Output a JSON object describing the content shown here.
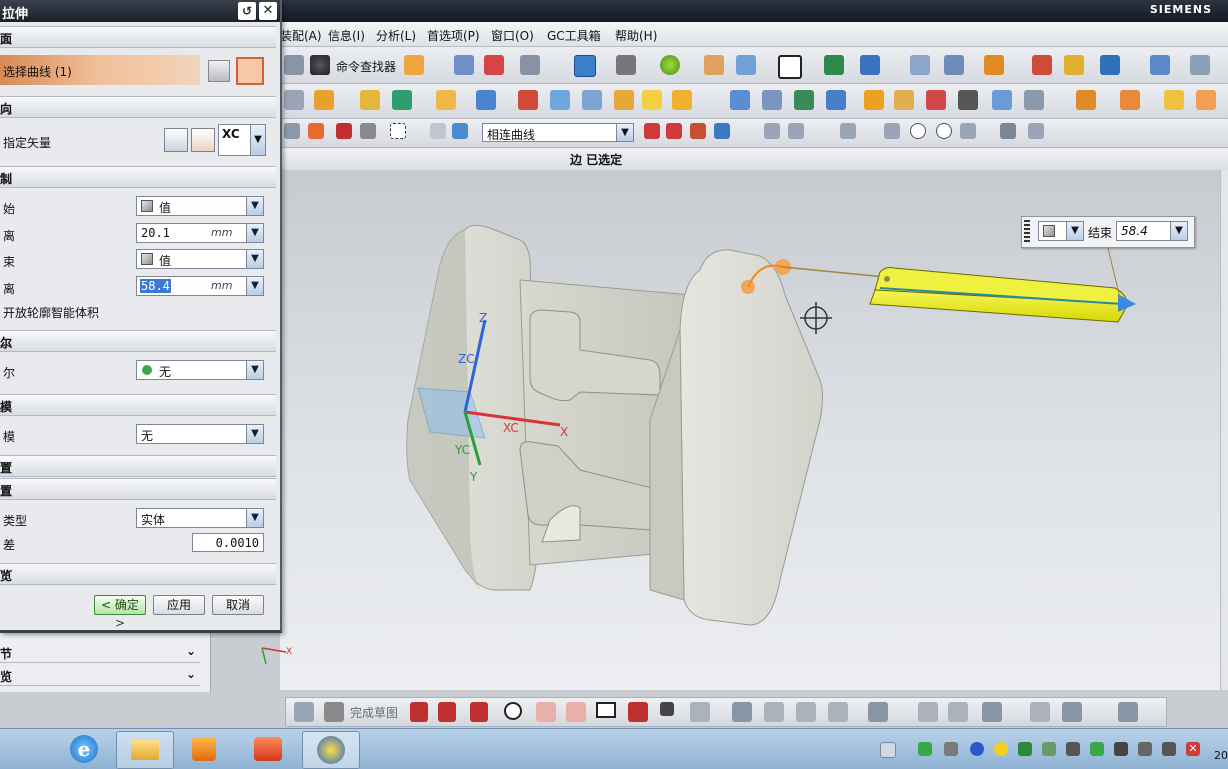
{
  "brand": "SIEMENS",
  "dialog": {
    "title": "拉伸",
    "sections": {
      "section": "面",
      "direction": "向",
      "limits": "制",
      "boolean": "尔",
      "draft": "模",
      "offset": "置",
      "settings": "置",
      "preview": "览"
    },
    "select_curve": "选择曲线 (1)",
    "specify_vector": "指定矢量",
    "vector_axis": "XC",
    "start_label": "始",
    "start_value": "值",
    "distance_label_1": "离",
    "distance_1": "20.1",
    "unit_1": "mm",
    "end_label": "束",
    "end_value": "值",
    "distance_label_2": "离",
    "distance_2": "58.4",
    "unit_2": "mm",
    "open_profile": "开放轮廓智能体积",
    "boolean_label": "尔",
    "boolean_value": "无",
    "draft_label": "模",
    "draft_value": "无",
    "body_type_label": "类型",
    "body_type_value": "实体",
    "tolerance_label": "差",
    "tolerance_value": "0.0010",
    "ok": "< 确定 >",
    "apply": "应用",
    "cancel": "取消"
  },
  "menubar": [
    "装配(A)",
    "信息(I)",
    "分析(L)",
    "首选项(P)",
    "窗口(O)",
    "GC工具箱",
    "帮助(H)"
  ],
  "toolbar": {
    "command_finder": "命令查找器",
    "curve_rule": "相连曲线",
    "finish_sketch": "完成草图"
  },
  "status": {
    "selection": "边 已选定"
  },
  "float_input": {
    "label": "结束",
    "value": "58.4"
  },
  "nav_panel": [
    "节",
    "览"
  ],
  "axes": {
    "z": "Z",
    "zc": "ZC",
    "x": "X",
    "xc": "XC",
    "y": "Y",
    "yc": "YC"
  },
  "taskbar": {
    "clock": "20"
  },
  "colors": {
    "title_bar": "#1b1f27",
    "selected_row": "#e8a878",
    "extrude_preview": "#f0f020",
    "vector_arrow": "#3a8ae0"
  }
}
